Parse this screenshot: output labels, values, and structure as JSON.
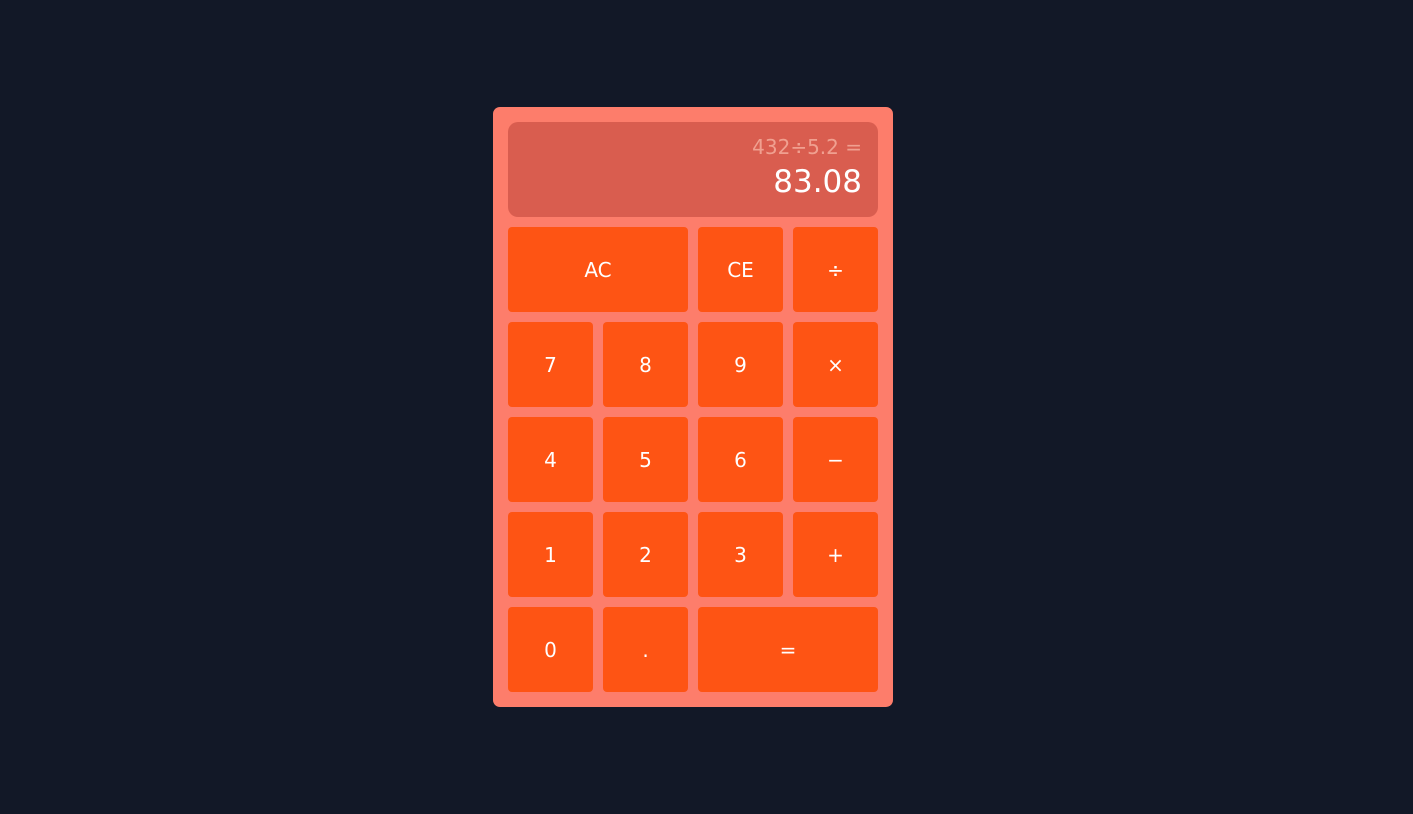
{
  "colors": {
    "page_background": "#121827",
    "calculator_body": "#fd7d6b",
    "display_background": "#d95d4f",
    "key_background": "#fe5414",
    "key_text": "#ffffff"
  },
  "display": {
    "expression": "432÷5.2 =",
    "result": "83.08"
  },
  "keys": {
    "ac": "AC",
    "ce": "CE",
    "divide": "÷",
    "seven": "7",
    "eight": "8",
    "nine": "9",
    "multiply": "×",
    "four": "4",
    "five": "5",
    "six": "6",
    "subtract": "−",
    "one": "1",
    "two": "2",
    "three": "3",
    "add": "+",
    "zero": "0",
    "decimal": ".",
    "equals": "="
  }
}
